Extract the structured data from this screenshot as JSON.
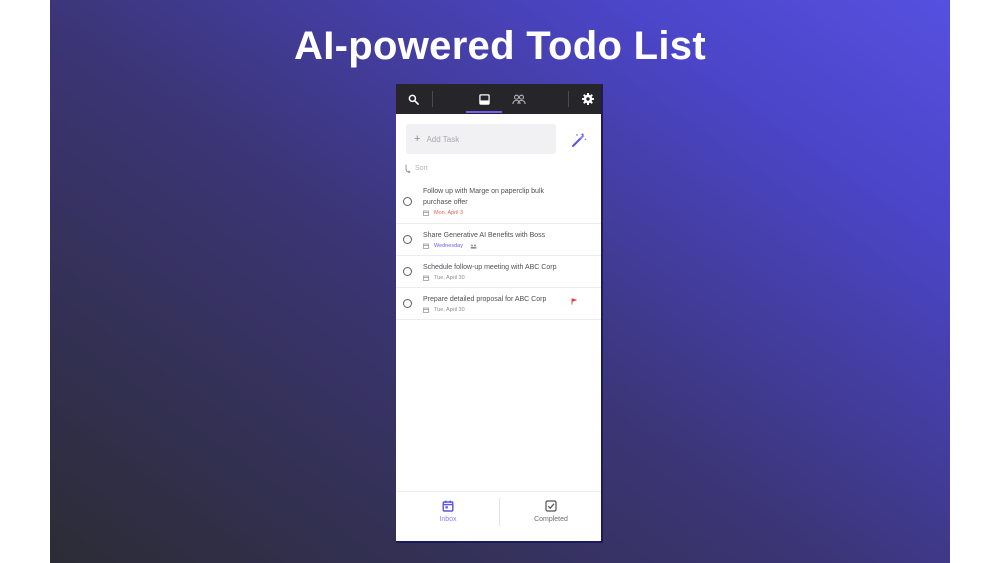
{
  "headline": "AI-powered Todo List",
  "topbar": {
    "search_icon": "search-icon",
    "inbox_icon": "inbox-tray-icon",
    "shared_icon": "people-icon",
    "settings_icon": "gear-icon"
  },
  "add_task": {
    "placeholder": "Add Task",
    "icon": "plus-icon",
    "magic_icon": "magic-wand-icon"
  },
  "sort": {
    "label": "Sort",
    "icon": "sort-icon"
  },
  "tasks": [
    {
      "title": "Follow up with Marge on paperclip bulk purchase offer",
      "date": "Mon, April 3",
      "date_color": "#e0635a"
    },
    {
      "title": "Share Generative AI Benefits with Boss",
      "date": "Wednesday",
      "date_color": "#6a63e8"
    },
    {
      "title": "Schedule follow-up meeting with ABC Corp",
      "date": "Tue, April 30",
      "date_color": "#8d8d93"
    },
    {
      "title": "Prepare detailed proposal for ABC Corp",
      "date": "Tue, April 30",
      "date_color": "#8d8d93",
      "flag_color": "#e04040"
    }
  ],
  "bottom_nav": {
    "inbox_label": "Inbox",
    "completed_label": "Completed"
  },
  "colors": {
    "accent": "#6d63f0",
    "topbar": "#26262a",
    "overdue": "#e0635a"
  }
}
